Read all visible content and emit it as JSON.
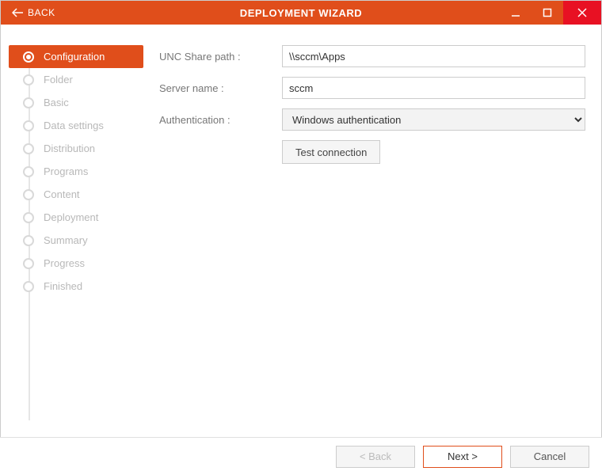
{
  "titlebar": {
    "back_label": "BACK",
    "title": "DEPLOYMENT WIZARD"
  },
  "steps": [
    {
      "label": "Configuration",
      "active": true
    },
    {
      "label": "Folder",
      "active": false
    },
    {
      "label": "Basic",
      "active": false
    },
    {
      "label": "Data settings",
      "active": false
    },
    {
      "label": "Distribution",
      "active": false
    },
    {
      "label": "Programs",
      "active": false
    },
    {
      "label": "Content",
      "active": false
    },
    {
      "label": "Deployment",
      "active": false
    },
    {
      "label": "Summary",
      "active": false
    },
    {
      "label": "Progress",
      "active": false
    },
    {
      "label": "Finished",
      "active": false
    }
  ],
  "form": {
    "unc_label": "UNC Share path :",
    "unc_value": "\\\\sccm\\Apps",
    "server_label": "Server name :",
    "server_value": "sccm",
    "auth_label": "Authentication :",
    "auth_value": "Windows authentication",
    "test_label": "Test connection"
  },
  "footer": {
    "back_label": "< Back",
    "next_label": "Next >",
    "cancel_label": "Cancel"
  }
}
